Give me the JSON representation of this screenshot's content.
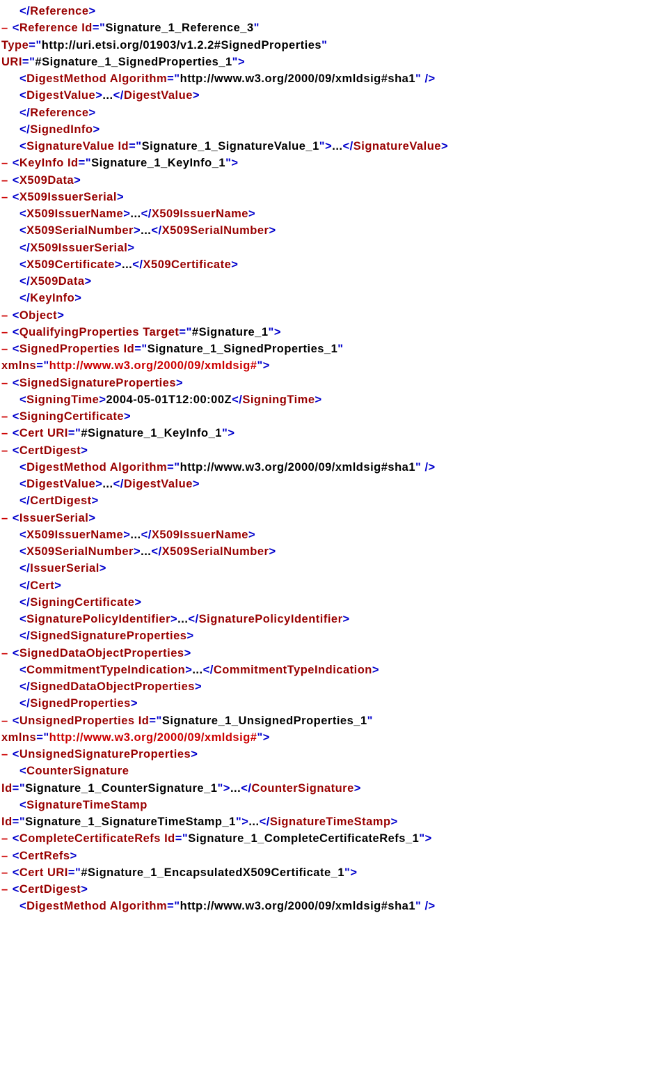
{
  "s": {
    "sha1": "http://www.w3.org/2000/09/xmldsig#sha1",
    "spType": "http://uri.etsi.org/01903/v1.2.2#SignedProperties",
    "xmlns": "http://www.w3.org/2000/09/xmldsig#",
    "spUri": "#Signature_1_SignedProperties_1",
    "refId": "Signature_1_Reference_3",
    "sigvalId": "Signature_1_SignatureValue_1",
    "keyId": "Signature_1_KeyInfo_1",
    "qpTarget": "#Signature_1",
    "spId": "Signature_1_SignedProperties_1",
    "time": "2004-05-01T12:00:00Z",
    "certUri": "#Signature_1_KeyInfo_1",
    "upId": "Signature_1_UnsignedProperties_1",
    "csId": "Signature_1_CounterSignature_1",
    "stsId": "Signature_1_SignatureTimeStamp_1",
    "ccrId": "Signature_1_CompleteCertificateRefs_1",
    "encapUri": "#Signature_1_EncapsulatedX509Certificate_1"
  },
  "t": {
    "ell": "...",
    "dash": "–",
    "lt": "<",
    "gt": ">",
    "slashgt": "/>",
    "ltslash": "</",
    "q": "\"",
    "eq": "=",
    "Reference": "Reference",
    "Id": "Id",
    "Type": "Type",
    "URI": "URI",
    "DigestMethod": "DigestMethod",
    "Algorithm": "Algorithm",
    "DigestValue": "DigestValue",
    "SignedInfo": "SignedInfo",
    "SignatureValue": "SignatureValue",
    "KeyInfo": "KeyInfo",
    "X509Data": "X509Data",
    "X509IssuerSerial": "X509IssuerSerial",
    "X509IssuerName": "X509IssuerName",
    "X509SerialNumber": "X509SerialNumber",
    "X509Certificate": "X509Certificate",
    "Object": "Object",
    "QualifyingProperties": "QualifyingProperties",
    "Target": "Target",
    "SignedProperties": "SignedProperties",
    "xmlnsW": "xmlns",
    "SignedSignatureProperties": "SignedSignatureProperties",
    "SigningTime": "SigningTime",
    "SigningCertificate": "SigningCertificate",
    "Cert": "Cert",
    "CertDigest": "CertDigest",
    "IssuerSerial": "IssuerSerial",
    "SignaturePolicyIdentifier": "SignaturePolicyIdentifier",
    "SignedDataObjectProperties": "SignedDataObjectProperties",
    "CommitmentTypeIndication": "CommitmentTypeIndication",
    "UnsignedProperties": "UnsignedProperties",
    "UnsignedSignatureProperties": "UnsignedSignatureProperties",
    "CounterSignature": "CounterSignature",
    "SignatureTimeStamp": "SignatureTimeStamp",
    "CompleteCertificateRefs": "CompleteCertificateRefs",
    "CertRefs": "CertRefs"
  }
}
